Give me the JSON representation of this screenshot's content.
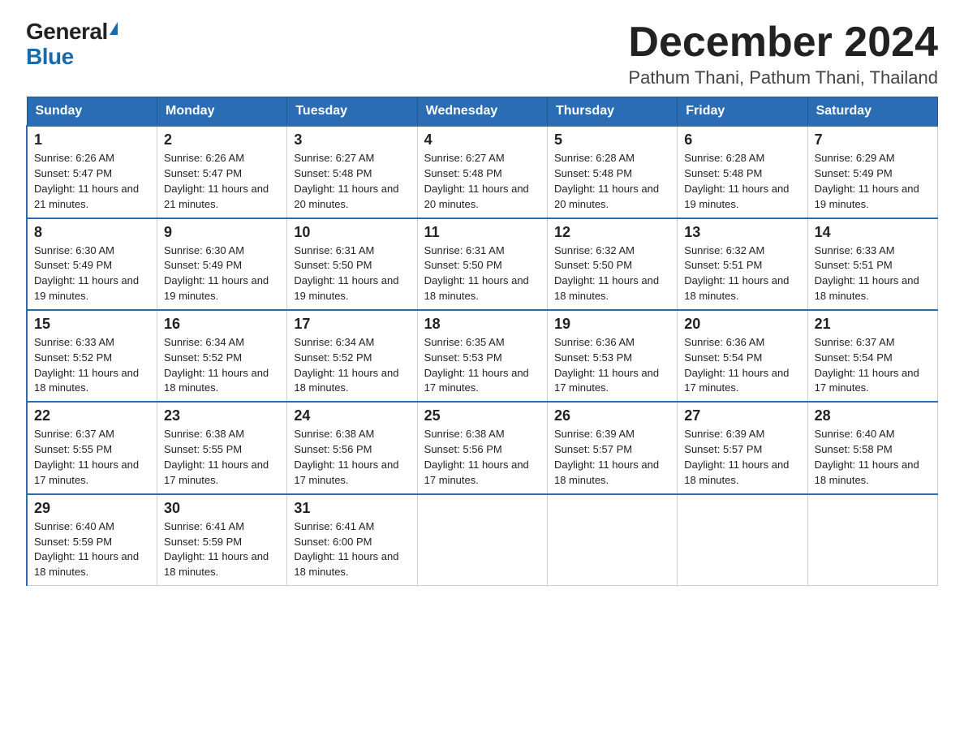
{
  "logo": {
    "general": "General",
    "blue": "Blue"
  },
  "header": {
    "month_title": "December 2024",
    "location": "Pathum Thani, Pathum Thani, Thailand"
  },
  "calendar": {
    "days_of_week": [
      "Sunday",
      "Monday",
      "Tuesday",
      "Wednesday",
      "Thursday",
      "Friday",
      "Saturday"
    ],
    "weeks": [
      [
        {
          "day": "1",
          "sunrise": "6:26 AM",
          "sunset": "5:47 PM",
          "daylight": "11 hours and 21 minutes."
        },
        {
          "day": "2",
          "sunrise": "6:26 AM",
          "sunset": "5:47 PM",
          "daylight": "11 hours and 21 minutes."
        },
        {
          "day": "3",
          "sunrise": "6:27 AM",
          "sunset": "5:48 PM",
          "daylight": "11 hours and 20 minutes."
        },
        {
          "day": "4",
          "sunrise": "6:27 AM",
          "sunset": "5:48 PM",
          "daylight": "11 hours and 20 minutes."
        },
        {
          "day": "5",
          "sunrise": "6:28 AM",
          "sunset": "5:48 PM",
          "daylight": "11 hours and 20 minutes."
        },
        {
          "day": "6",
          "sunrise": "6:28 AM",
          "sunset": "5:48 PM",
          "daylight": "11 hours and 19 minutes."
        },
        {
          "day": "7",
          "sunrise": "6:29 AM",
          "sunset": "5:49 PM",
          "daylight": "11 hours and 19 minutes."
        }
      ],
      [
        {
          "day": "8",
          "sunrise": "6:30 AM",
          "sunset": "5:49 PM",
          "daylight": "11 hours and 19 minutes."
        },
        {
          "day": "9",
          "sunrise": "6:30 AM",
          "sunset": "5:49 PM",
          "daylight": "11 hours and 19 minutes."
        },
        {
          "day": "10",
          "sunrise": "6:31 AM",
          "sunset": "5:50 PM",
          "daylight": "11 hours and 19 minutes."
        },
        {
          "day": "11",
          "sunrise": "6:31 AM",
          "sunset": "5:50 PM",
          "daylight": "11 hours and 18 minutes."
        },
        {
          "day": "12",
          "sunrise": "6:32 AM",
          "sunset": "5:50 PM",
          "daylight": "11 hours and 18 minutes."
        },
        {
          "day": "13",
          "sunrise": "6:32 AM",
          "sunset": "5:51 PM",
          "daylight": "11 hours and 18 minutes."
        },
        {
          "day": "14",
          "sunrise": "6:33 AM",
          "sunset": "5:51 PM",
          "daylight": "11 hours and 18 minutes."
        }
      ],
      [
        {
          "day": "15",
          "sunrise": "6:33 AM",
          "sunset": "5:52 PM",
          "daylight": "11 hours and 18 minutes."
        },
        {
          "day": "16",
          "sunrise": "6:34 AM",
          "sunset": "5:52 PM",
          "daylight": "11 hours and 18 minutes."
        },
        {
          "day": "17",
          "sunrise": "6:34 AM",
          "sunset": "5:52 PM",
          "daylight": "11 hours and 18 minutes."
        },
        {
          "day": "18",
          "sunrise": "6:35 AM",
          "sunset": "5:53 PM",
          "daylight": "11 hours and 17 minutes."
        },
        {
          "day": "19",
          "sunrise": "6:36 AM",
          "sunset": "5:53 PM",
          "daylight": "11 hours and 17 minutes."
        },
        {
          "day": "20",
          "sunrise": "6:36 AM",
          "sunset": "5:54 PM",
          "daylight": "11 hours and 17 minutes."
        },
        {
          "day": "21",
          "sunrise": "6:37 AM",
          "sunset": "5:54 PM",
          "daylight": "11 hours and 17 minutes."
        }
      ],
      [
        {
          "day": "22",
          "sunrise": "6:37 AM",
          "sunset": "5:55 PM",
          "daylight": "11 hours and 17 minutes."
        },
        {
          "day": "23",
          "sunrise": "6:38 AM",
          "sunset": "5:55 PM",
          "daylight": "11 hours and 17 minutes."
        },
        {
          "day": "24",
          "sunrise": "6:38 AM",
          "sunset": "5:56 PM",
          "daylight": "11 hours and 17 minutes."
        },
        {
          "day": "25",
          "sunrise": "6:38 AM",
          "sunset": "5:56 PM",
          "daylight": "11 hours and 17 minutes."
        },
        {
          "day": "26",
          "sunrise": "6:39 AM",
          "sunset": "5:57 PM",
          "daylight": "11 hours and 18 minutes."
        },
        {
          "day": "27",
          "sunrise": "6:39 AM",
          "sunset": "5:57 PM",
          "daylight": "11 hours and 18 minutes."
        },
        {
          "day": "28",
          "sunrise": "6:40 AM",
          "sunset": "5:58 PM",
          "daylight": "11 hours and 18 minutes."
        }
      ],
      [
        {
          "day": "29",
          "sunrise": "6:40 AM",
          "sunset": "5:59 PM",
          "daylight": "11 hours and 18 minutes."
        },
        {
          "day": "30",
          "sunrise": "6:41 AM",
          "sunset": "5:59 PM",
          "daylight": "11 hours and 18 minutes."
        },
        {
          "day": "31",
          "sunrise": "6:41 AM",
          "sunset": "6:00 PM",
          "daylight": "11 hours and 18 minutes."
        },
        null,
        null,
        null,
        null
      ]
    ]
  }
}
